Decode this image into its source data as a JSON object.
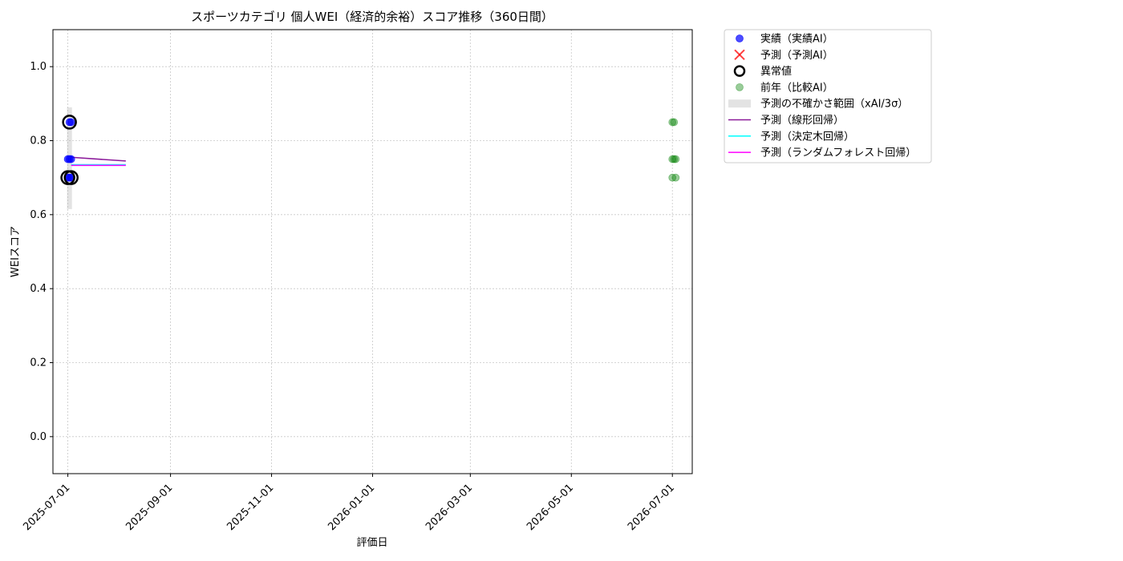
{
  "chart_data": {
    "type": "scatter",
    "title": "スポーツカテゴリ 個人WEI（経済的余裕）スコア推移（360日間）",
    "xlabel": "評価日",
    "ylabel": "WEIスコア",
    "xlim": [
      "2025-06-22",
      "2026-07-13"
    ],
    "ylim": [
      -0.1,
      1.1
    ],
    "x_ticks": [
      "2025-07-01",
      "2025-09-01",
      "2025-11-01",
      "2026-01-01",
      "2026-03-01",
      "2026-05-01",
      "2026-07-01"
    ],
    "y_ticks": [
      0.0,
      0.2,
      0.4,
      0.6,
      0.8,
      1.0
    ],
    "y_tick_labels": [
      "0.0",
      "0.2",
      "0.4",
      "0.6",
      "0.8",
      "1.0"
    ],
    "grid": true,
    "legend_position": "outside-right-top",
    "series": [
      {
        "name": "実績（実績AI）",
        "kind": "scatter",
        "color": "#0000ff",
        "points": [
          {
            "x": "2025-07-01",
            "y": 0.7
          },
          {
            "x": "2025-07-01",
            "y": 0.75
          },
          {
            "x": "2025-07-02",
            "y": 0.75
          },
          {
            "x": "2025-07-02",
            "y": 0.85
          },
          {
            "x": "2025-07-02",
            "y": 0.7
          },
          {
            "x": "2025-07-03",
            "y": 0.75
          },
          {
            "x": "2025-07-03",
            "y": 0.85
          },
          {
            "x": "2025-07-03",
            "y": 0.7
          }
        ]
      },
      {
        "name": "予測（予測AI）",
        "kind": "x-marker",
        "color": "#ff0000",
        "points": []
      },
      {
        "name": "異常値",
        "kind": "ring",
        "color": "#000000",
        "points": [
          {
            "x": "2025-07-01",
            "y": 0.7
          },
          {
            "x": "2025-07-02",
            "y": 0.85
          },
          {
            "x": "2025-07-03",
            "y": 0.7
          }
        ]
      },
      {
        "name": "前年（比較AI）",
        "kind": "scatter",
        "color": "#008000",
        "points": [
          {
            "x": "2026-07-01",
            "y": 0.85
          },
          {
            "x": "2026-07-01",
            "y": 0.75
          },
          {
            "x": "2026-07-01",
            "y": 0.7
          },
          {
            "x": "2026-07-02",
            "y": 0.75
          },
          {
            "x": "2026-07-02",
            "y": 0.85
          },
          {
            "x": "2026-07-03",
            "y": 0.75
          },
          {
            "x": "2026-07-03",
            "y": 0.7
          }
        ]
      },
      {
        "name": "予測の不確かさ範囲（xAI/3σ）",
        "kind": "band",
        "color": "#b0b0b0",
        "x_start": "2025-07-01",
        "x_end": "2025-07-03",
        "y_low": 0.615,
        "y_high": 0.89
      },
      {
        "name": "予測（線形回帰）",
        "kind": "line",
        "color": "#8b1a9a",
        "points": [
          {
            "x": "2025-07-03",
            "y": 0.755
          },
          {
            "x": "2025-08-05",
            "y": 0.745
          }
        ]
      },
      {
        "name": "予測（決定木回帰）",
        "kind": "line",
        "color": "#00ffff",
        "points": [
          {
            "x": "2025-07-03",
            "y": 0.735
          },
          {
            "x": "2025-08-05",
            "y": 0.735
          }
        ]
      },
      {
        "name": "予測（ランダムフォレスト回帰）",
        "kind": "line",
        "color": "#ff00ff",
        "points": [
          {
            "x": "2025-07-03",
            "y": 0.733
          },
          {
            "x": "2025-08-05",
            "y": 0.733
          }
        ]
      }
    ]
  }
}
